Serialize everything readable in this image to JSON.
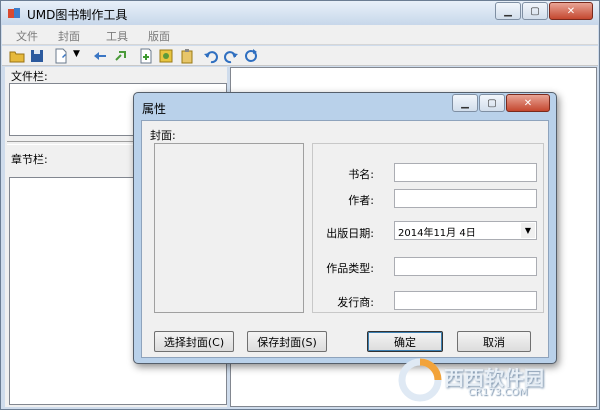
{
  "app": {
    "title": "UMD图书制作工具"
  },
  "menu": [
    "文件",
    "封面",
    "工具",
    "版面"
  ],
  "left_pane": {
    "files_label": "文件栏:",
    "chapters_label": "章节栏:"
  },
  "dialog": {
    "title": "属性",
    "cover_label": "封面:",
    "fields": {
      "book_name_label": "书名:",
      "author_label": "作者:",
      "publish_date_label": "出版日期:",
      "publish_date_value": "2014年11月  4日",
      "genre_label": "作品类型:",
      "publisher_label": "发行商:"
    },
    "buttons": {
      "choose_cover": "选择封面(C)",
      "save_cover": "保存封面(S)",
      "ok": "确定",
      "cancel": "取消"
    }
  },
  "watermark": {
    "brand": "西西软件园",
    "url": "CR173.COM"
  }
}
